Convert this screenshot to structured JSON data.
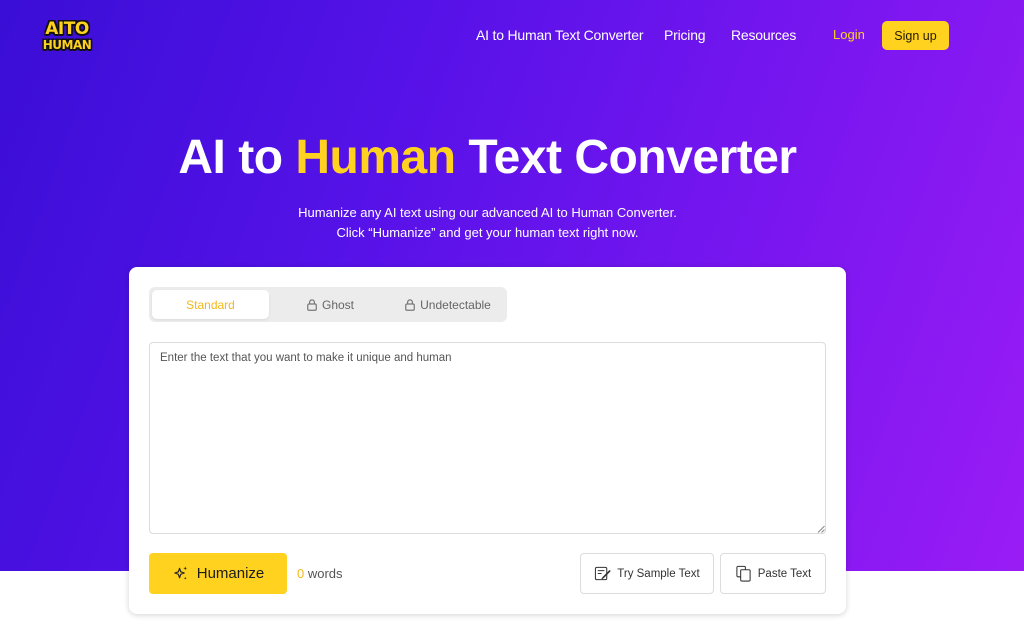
{
  "nav": {
    "logo_line1": "AITO",
    "logo_line2": "HUMAN",
    "links": [
      "AI to Human Text Converter",
      "Pricing",
      "Resources"
    ],
    "login": "Login",
    "signup": "Sign up"
  },
  "hero": {
    "title_before": "AI to ",
    "title_highlight": "Human",
    "title_after": " Text Converter",
    "subtitle_line1": "Humanize any AI text using our advanced AI to Human Converter.",
    "subtitle_line2": "Click “Humanize” and get your human text right now."
  },
  "converter": {
    "tabs": [
      "Standard",
      "Ghost",
      "Undetectable"
    ],
    "active_tab": "Standard",
    "input_placeholder": "Enter the text that you want to make it unique and human",
    "input_value": "",
    "humanize_label": "Humanize",
    "word_count": "0",
    "word_label": " words",
    "sample_label": "Try Sample Text",
    "paste_label": "Paste Text"
  },
  "colors": {
    "accent": "#ffd21f",
    "hero_start": "#3a0ed6",
    "hero_end": "#9a1cf5"
  },
  "icons": [
    "lock-icon",
    "sparkle-icon",
    "sample-text-icon",
    "paste-icon"
  ]
}
